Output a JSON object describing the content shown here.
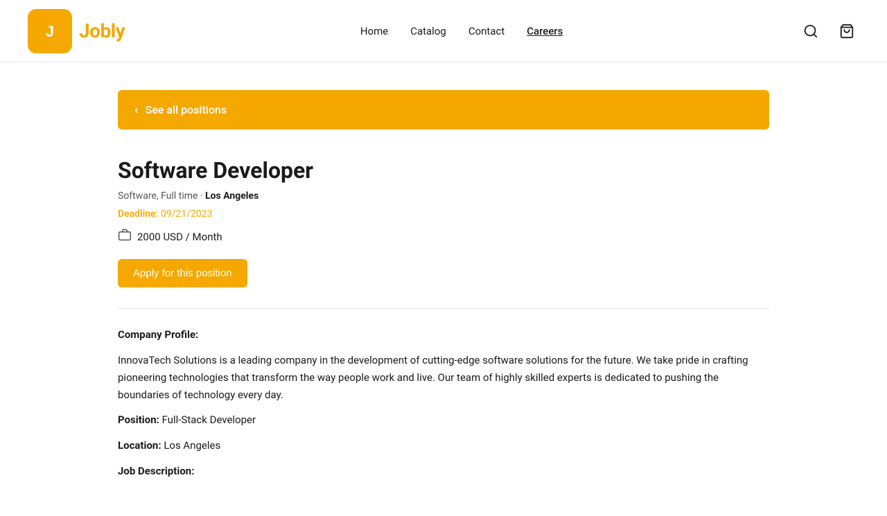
{
  "header": {
    "logo_text": "Jobly",
    "logo_icon_char": "J",
    "nav": [
      {
        "label": "Home",
        "active": false
      },
      {
        "label": "Catalog",
        "active": false
      },
      {
        "label": "Contact",
        "active": false
      },
      {
        "label": "Careers",
        "active": true
      }
    ],
    "icons": {
      "search": "🔍",
      "cart": "🛒"
    }
  },
  "back_button": {
    "label": "See all positions",
    "chevron": "‹"
  },
  "job": {
    "title": "Software Developer",
    "category": "Software",
    "type": "Full time",
    "dot": "·",
    "location": "Los Angeles",
    "deadline_label": "Deadline:",
    "deadline_value": "09/21/2023",
    "salary": "2000 USD / Month",
    "apply_label": "Apply for this position"
  },
  "company_profile": {
    "section_title": "Company Profile:",
    "description": "InnovaTech Solutions is a leading company in the development of cutting-edge software solutions for the future. We take pride in crafting pioneering technologies that transform the way people work and live. Our team of highly skilled experts is dedicated to pushing the boundaries of technology every day.",
    "position_label": "Position:",
    "position_value": "Full-Stack Developer",
    "location_label": "Location:",
    "location_value": "Los Angeles",
    "job_desc_label": "Job Description:"
  }
}
